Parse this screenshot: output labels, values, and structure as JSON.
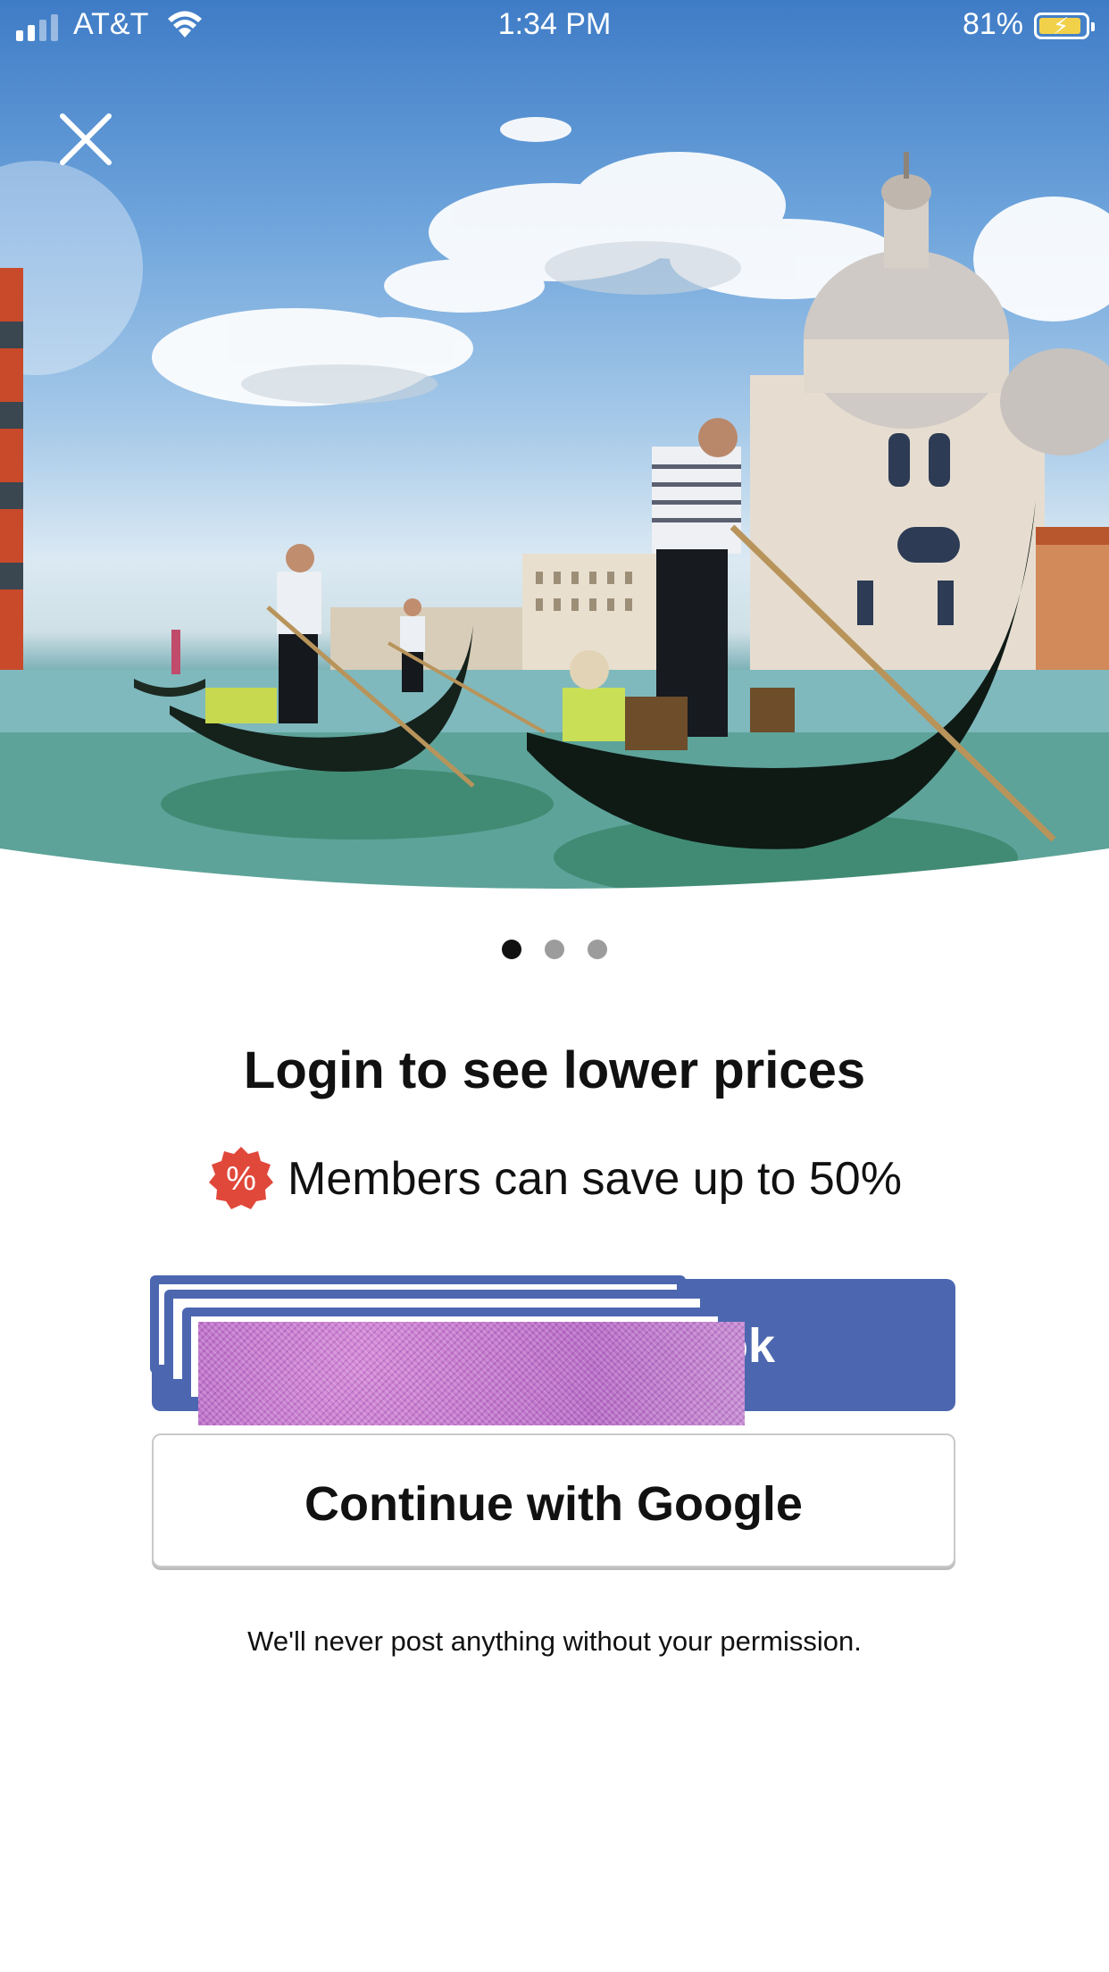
{
  "status_bar": {
    "carrier": "AT&T",
    "time": "1:34 PM",
    "battery_percent": "81%",
    "battery_level": 0.81
  },
  "icons": {
    "close": "close-icon",
    "wifi": "wifi-icon",
    "percent_badge": "percent-badge-icon"
  },
  "pager": {
    "total": 3,
    "active_index": 0
  },
  "content": {
    "title": "Login to see lower prices",
    "subtitle": "Members can save up to 50%",
    "badge_symbol": "%"
  },
  "buttons": {
    "facebook_label_visible": "ook",
    "google_label": "Continue with Google"
  },
  "footer": {
    "disclaimer": "We'll never post anything without your permission."
  },
  "colors": {
    "facebook_blue": "#4c67b0",
    "badge_red": "#e0483a",
    "active_dot": "#111111",
    "inactive_dot": "#9c9c9c"
  }
}
